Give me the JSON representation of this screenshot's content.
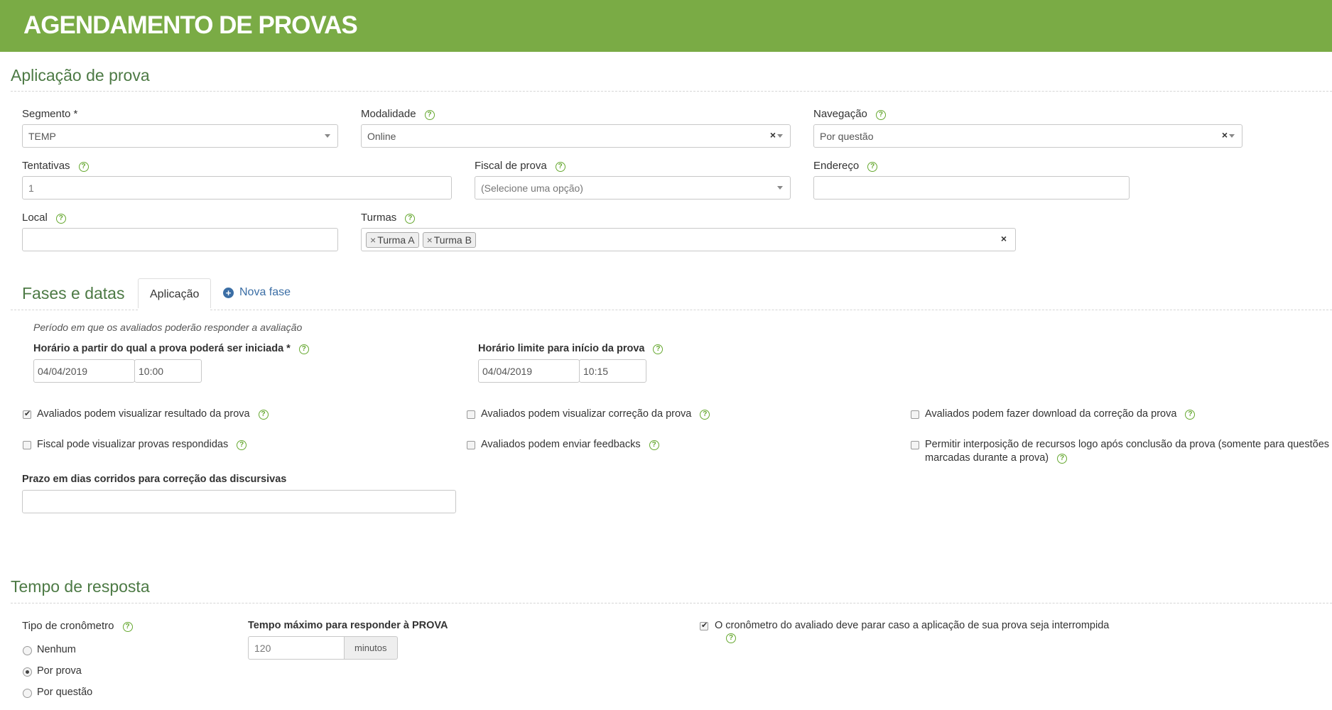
{
  "header": {
    "title": "AGENDAMENTO DE PROVAS"
  },
  "aplicacao": {
    "title": "Aplicação de prova",
    "segmento": {
      "label": "Segmento *",
      "value": "TEMP"
    },
    "modalidade": {
      "label": "Modalidade",
      "value": "Online"
    },
    "navegacao": {
      "label": "Navegação",
      "value": "Por questão"
    },
    "tentativas": {
      "label": "Tentativas",
      "value": "1"
    },
    "fiscal": {
      "label": "Fiscal de prova",
      "placeholder": "(Selecione uma opção)"
    },
    "endereco": {
      "label": "Endereço",
      "value": ""
    },
    "local": {
      "label": "Local",
      "value": ""
    },
    "turmas": {
      "label": "Turmas",
      "tags": [
        "Turma A",
        "Turma B"
      ]
    }
  },
  "fases": {
    "title": "Fases e datas",
    "tab_active": "Aplicação",
    "new_phase": "Nova fase",
    "period_note": "Período em que os avaliados poderão responder a avaliação",
    "inicio": {
      "label": "Horário a partir do qual a prova poderá ser iniciada *",
      "date": "04/04/2019",
      "time": "10:00"
    },
    "limite": {
      "label": "Horário limite para início da prova",
      "date": "04/04/2019",
      "time": "10:15"
    }
  },
  "options": {
    "ver_resultado": {
      "label": "Avaliados podem visualizar resultado da prova",
      "checked": true
    },
    "ver_correcao": {
      "label": "Avaliados podem visualizar correção da prova",
      "checked": false
    },
    "download_correcao": {
      "label": "Avaliados podem fazer download da correção da prova",
      "checked": false
    },
    "fiscal_ver": {
      "label": "Fiscal pode visualizar provas respondidas",
      "checked": false
    },
    "feedbacks": {
      "label": "Avaliados podem enviar feedbacks",
      "checked": false
    },
    "recursos": {
      "label_line1": "Permitir interposição de recursos logo após conclusão da prova (somente para questões",
      "label_line2": "marcadas durante a prova)",
      "checked": false
    }
  },
  "prazo": {
    "label": "Prazo em dias corridos para correção das discursivas",
    "value": ""
  },
  "tempo": {
    "title": "Tempo de resposta",
    "tipo_label": "Tipo de cronômetro",
    "radios": [
      {
        "label": "Nenhum",
        "checked": false
      },
      {
        "label": "Por prova",
        "checked": true
      },
      {
        "label": "Por questão",
        "checked": false
      }
    ],
    "max_label": "Tempo máximo para responder à PROVA",
    "max_value": "120",
    "max_unit": "minutos",
    "parar": {
      "label": "O cronômetro do avaliado deve parar caso a aplicação de sua prova seja interrompida",
      "checked": true
    }
  }
}
